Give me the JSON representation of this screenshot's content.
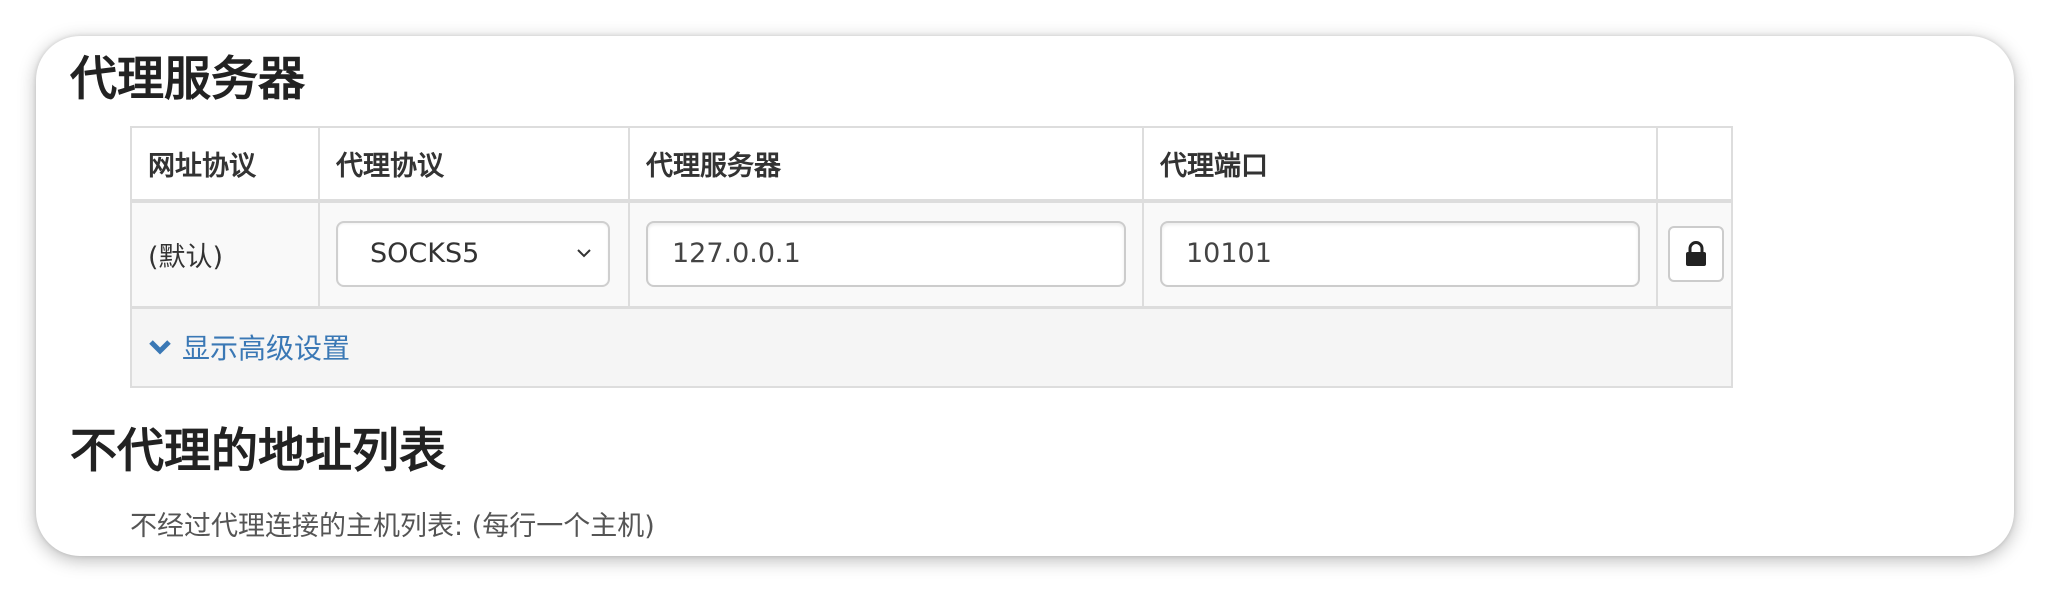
{
  "proxy_section": {
    "title": "代理服务器",
    "table": {
      "headers": [
        "网址协议",
        "代理协议",
        "代理服务器",
        "代理端口",
        ""
      ],
      "row": {
        "url_scheme": "(默认)",
        "protocol": "SOCKS5",
        "server": "127.0.0.1",
        "port": "10101"
      }
    },
    "advanced_label": "显示高级设置"
  },
  "bypass_section": {
    "title": "不代理的地址列表",
    "description": "不经过代理连接的主机列表: (每行一个主机)"
  },
  "icons": {
    "lock": "lock-icon",
    "advanced_toggle": "chevron-down-icon",
    "select_dropdown": "chevron-down-icon"
  },
  "colors": {
    "link": "#3a78b5",
    "border": "#dddddd",
    "row_background": "#f9f9f9"
  }
}
